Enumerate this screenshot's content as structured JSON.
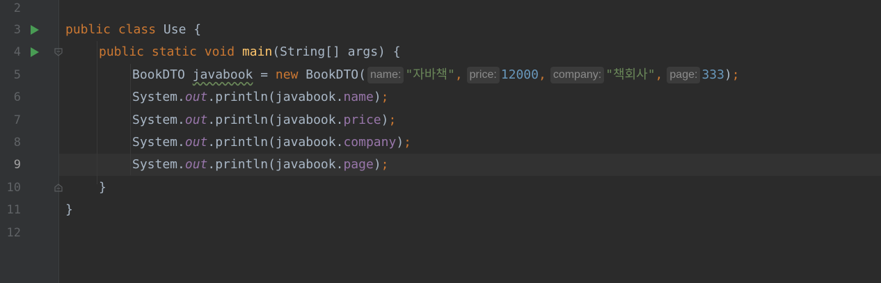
{
  "editor": {
    "line_numbers": [
      "2",
      "3",
      "4",
      "5",
      "6",
      "7",
      "8",
      "9",
      "10",
      "11",
      "12"
    ],
    "current_line": "9",
    "colors": {
      "background": "#2b2b2b",
      "keyword": "#cc7832",
      "string": "#6a8759",
      "number": "#6897bb",
      "field": "#9876aa",
      "method_decl": "#ffc66d",
      "text": "#a9b7c6",
      "run_icon": "#499c54"
    },
    "icons": {
      "run": "run-gutter-icon",
      "fold": "fold-icon"
    },
    "code": {
      "line3": {
        "kw1": "public",
        "kw2": "class",
        "name": "Use",
        "brace": " {"
      },
      "line4": {
        "kw1": "public",
        "kw2": "static",
        "kw3": "void",
        "method": "main",
        "params": "(String[] args) {"
      },
      "line5": {
        "type": "BookDTO",
        "var": "javabook",
        "eq": " = ",
        "kw_new": "new",
        "ctor": " BookDTO(",
        "hint_name": "name:",
        "arg_name": "\"자바책\"",
        "hint_price": "price:",
        "arg_price": "12000",
        "hint_company": "company:",
        "arg_company": "\"책회사\"",
        "hint_page": "page:",
        "arg_page": "333",
        "close": ")",
        "semi": ";",
        "comma": ","
      },
      "print_lines": [
        {
          "cls": "System.",
          "out": "out",
          "call": ".println(javabook.",
          "field": "name",
          "close": ")",
          "semi": ";"
        },
        {
          "cls": "System.",
          "out": "out",
          "call": ".println(javabook.",
          "field": "price",
          "close": ")",
          "semi": ";"
        },
        {
          "cls": "System.",
          "out": "out",
          "call": ".println(javabook.",
          "field": "company",
          "close": ")",
          "semi": ";"
        },
        {
          "cls": "System.",
          "out": "out",
          "call": ".println(javabook.",
          "field": "page",
          "close": ")",
          "semi": ";"
        }
      ],
      "line10": "}",
      "line11": "}"
    }
  }
}
